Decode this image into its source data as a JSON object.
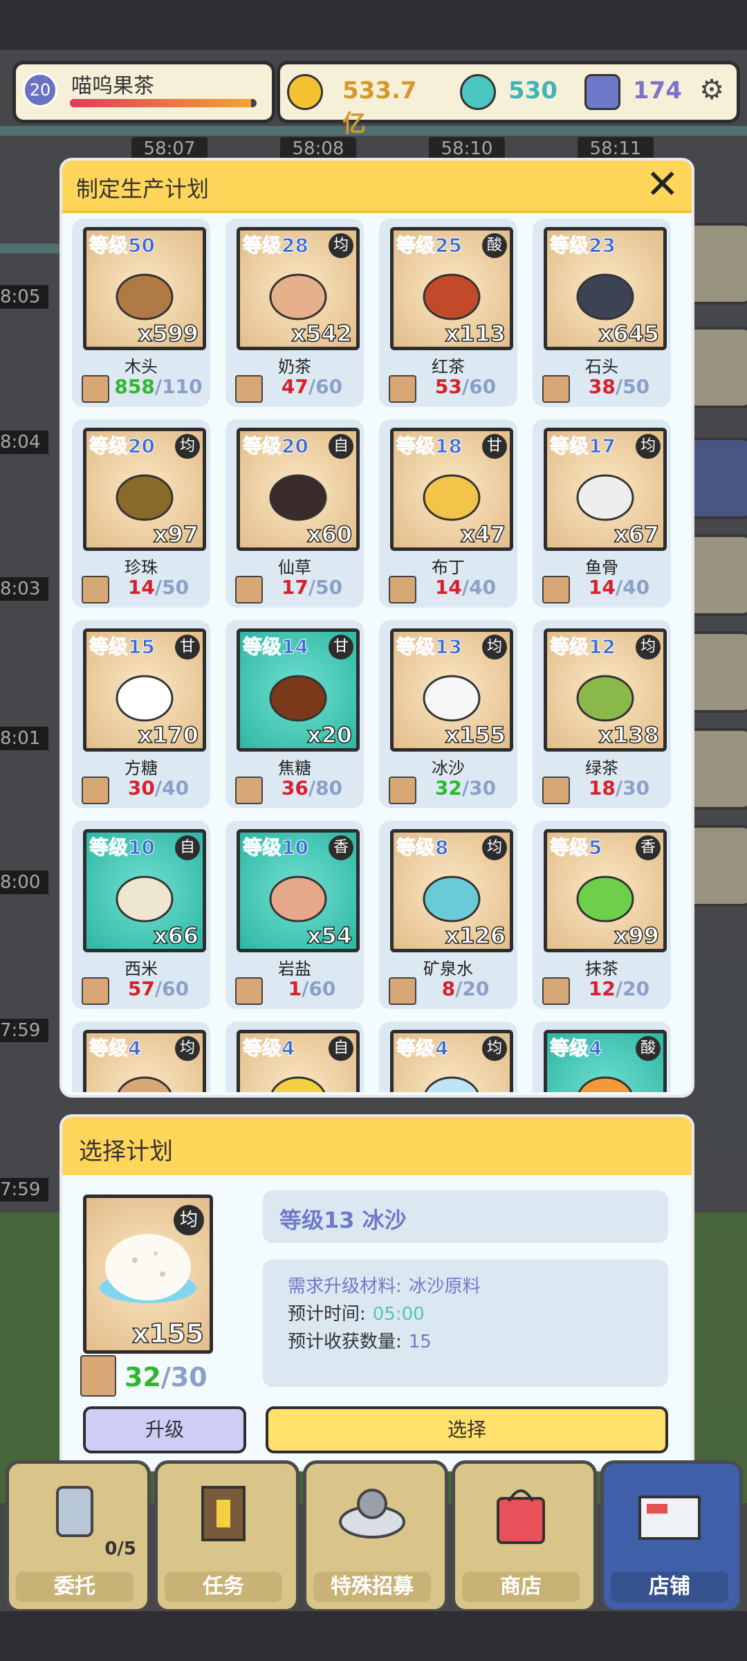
{
  "hud": {
    "player_level": "20",
    "player_name": "喵呜果茶",
    "hp_fraction": 0.97,
    "gold": "533.7亿",
    "gem": "530",
    "crystal": "174"
  },
  "background": {
    "timers": [
      "58:07",
      "58:08",
      "58:10",
      "58:11"
    ],
    "left_timers": [
      "8:05",
      "8:04",
      "8:03",
      "8:01",
      "8:00",
      "7:59",
      "7:59"
    ]
  },
  "plan_modal": {
    "title": "制定生产计划",
    "items": [
      {
        "level": "等级50",
        "tag": "",
        "qty": "x599",
        "name": "木头",
        "have": "858",
        "need": "/110",
        "ok": true
      },
      {
        "level": "等级28",
        "tag": "均",
        "qty": "x542",
        "name": "奶茶",
        "have": "47",
        "need": "/60",
        "ok": false
      },
      {
        "level": "等级25",
        "tag": "酸",
        "qty": "x113",
        "name": "红茶",
        "have": "53",
        "need": "/60",
        "ok": false
      },
      {
        "level": "等级23",
        "tag": "",
        "qty": "x645",
        "name": "石头",
        "have": "38",
        "need": "/50",
        "ok": false
      },
      {
        "level": "等级20",
        "tag": "均",
        "qty": "x97",
        "name": "珍珠",
        "have": "14",
        "need": "/50",
        "ok": false
      },
      {
        "level": "等级20",
        "tag": "自",
        "qty": "x60",
        "name": "仙草",
        "have": "17",
        "need": "/50",
        "ok": false
      },
      {
        "level": "等级18",
        "tag": "甘",
        "qty": "x47",
        "name": "布丁",
        "have": "14",
        "need": "/40",
        "ok": false
      },
      {
        "level": "等级17",
        "tag": "均",
        "qty": "x67",
        "name": "鱼骨",
        "have": "14",
        "need": "/40",
        "ok": false
      },
      {
        "level": "等级15",
        "tag": "甘",
        "qty": "x170",
        "name": "方糖",
        "have": "30",
        "need": "/40",
        "ok": false
      },
      {
        "level": "等级14",
        "tag": "甘",
        "qty": "x20",
        "name": "焦糖",
        "have": "36",
        "need": "/80",
        "ok": false
      },
      {
        "level": "等级13",
        "tag": "均",
        "qty": "x155",
        "name": "冰沙",
        "have": "32",
        "need": "/30",
        "ok": true
      },
      {
        "level": "等级12",
        "tag": "均",
        "qty": "x138",
        "name": "绿茶",
        "have": "18",
        "need": "/30",
        "ok": false
      },
      {
        "level": "等级10",
        "tag": "自",
        "qty": "x66",
        "name": "西米",
        "have": "57",
        "need": "/60",
        "ok": false
      },
      {
        "level": "等级10",
        "tag": "香",
        "qty": "x54",
        "name": "岩盐",
        "have": "1",
        "need": "/60",
        "ok": false
      },
      {
        "level": "等级8",
        "tag": "均",
        "qty": "x126",
        "name": "矿泉水",
        "have": "8",
        "need": "/20",
        "ok": false
      },
      {
        "level": "等级5",
        "tag": "香",
        "qty": "x99",
        "name": "抹茶",
        "have": "12",
        "need": "/20",
        "ok": false
      },
      {
        "level": "等级4",
        "tag": "均",
        "qty": "",
        "name": "",
        "have": "",
        "need": "",
        "ok": false
      },
      {
        "level": "等级4",
        "tag": "自",
        "qty": "",
        "name": "",
        "have": "",
        "need": "",
        "ok": false
      },
      {
        "level": "等级4",
        "tag": "均",
        "qty": "",
        "name": "",
        "have": "",
        "need": "",
        "ok": false
      },
      {
        "level": "等级4",
        "tag": "酸",
        "qty": "",
        "name": "",
        "have": "",
        "need": "",
        "ok": false
      }
    ]
  },
  "select_panel": {
    "title": "选择计划",
    "item_tag": "均",
    "item_qty": "x155",
    "have": "32",
    "need": "/30",
    "name_line": "等级13 冰沙",
    "upgrade_key": "需求升级材料:",
    "upgrade_val": "冰沙原料",
    "time_key": "预计时间:",
    "time_val": "05:00",
    "yield_key": "预计收获数量:",
    "yield_val": "15",
    "upgrade_btn": "升级",
    "select_btn": "选择"
  },
  "nav": {
    "items": [
      {
        "label": "委托",
        "badge": "0/5"
      },
      {
        "label": "任务",
        "badge": ""
      },
      {
        "label": "特殊招募",
        "badge": ""
      },
      {
        "label": "商店",
        "badge": ""
      },
      {
        "label": "店铺",
        "badge": ""
      }
    ]
  },
  "colors": {
    "modal_header": "#ffd55a",
    "ok_count": "#2fb62f",
    "bad_count": "#d8202c",
    "level_text": "#3a6bd6",
    "active_nav": "#3f5fa9"
  }
}
